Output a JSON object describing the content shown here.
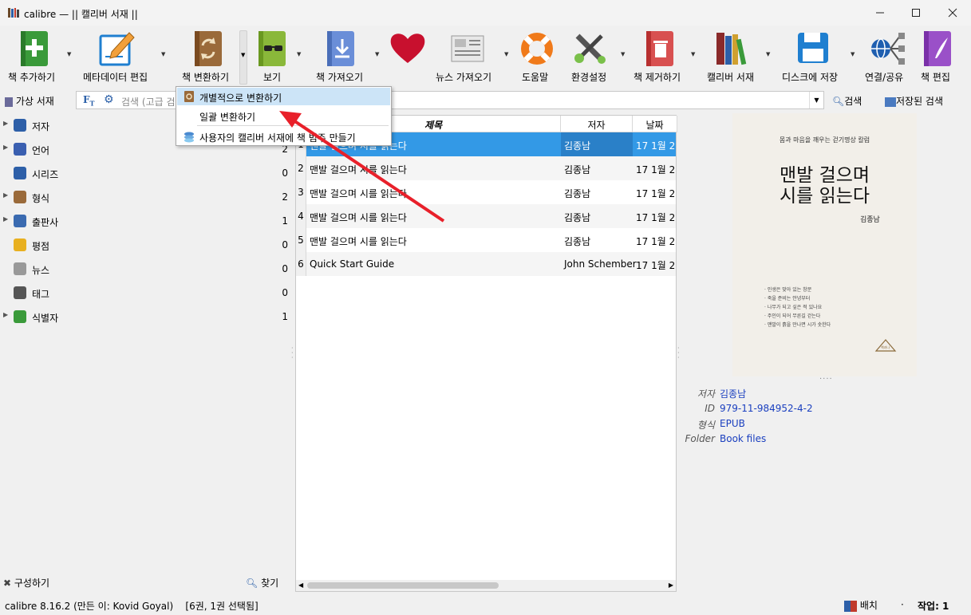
{
  "window": {
    "title": "calibre — || 캘리버 서재 ||",
    "controls": [
      "minimize",
      "maximize",
      "close"
    ]
  },
  "toolbar": {
    "items": [
      {
        "label": "책 추가하기",
        "icon": "add-book-icon",
        "has_menu": true
      },
      {
        "label": "메타데이터 편집",
        "icon": "edit-metadata-icon",
        "has_menu": true
      },
      {
        "label": "책 변환하기",
        "icon": "convert-book-icon",
        "has_menu": true
      },
      {
        "label": "보기",
        "icon": "view-book-icon",
        "has_menu": true
      },
      {
        "label": "책 가져오기",
        "icon": "get-books-icon",
        "has_menu": true
      },
      {
        "label": "",
        "icon": "heart-icon",
        "has_menu": false
      },
      {
        "label": "뉴스 가져오기",
        "icon": "news-icon",
        "has_menu": true
      },
      {
        "label": "도움말",
        "icon": "help-lifebuoy-icon",
        "has_menu": false
      },
      {
        "label": "환경설정",
        "icon": "preferences-icon",
        "has_menu": true
      },
      {
        "label": "책 제거하기",
        "icon": "remove-book-icon",
        "has_menu": true
      },
      {
        "label": "캘리버 서재",
        "icon": "library-icon",
        "has_menu": true
      },
      {
        "label": "디스크에 저장",
        "icon": "save-disk-icon",
        "has_menu": true
      },
      {
        "label": "연결/공유",
        "icon": "connect-share-icon",
        "has_menu": false
      },
      {
        "label": "책 편집",
        "icon": "edit-book-icon",
        "has_menu": false
      }
    ]
  },
  "search": {
    "virtual_library": "가상 서재",
    "placeholder": "검색 (고급 검",
    "search_button": "검색",
    "saved_search_button": "저장된 검색"
  },
  "convert_menu": {
    "items": [
      {
        "label": "개별적으로 변환하기",
        "icon": "convert-individual-icon"
      },
      {
        "label": "일괄 변환하기",
        "icon": ""
      },
      {
        "label": "사용자의 캘리버 서재에 책 범주 만들기",
        "icon": "library-category-icon"
      }
    ]
  },
  "tag_browser": {
    "items": [
      {
        "label": "저자",
        "count": "",
        "expandable": true,
        "icon": "author-icon"
      },
      {
        "label": "언어",
        "count": "2",
        "expandable": true,
        "icon": "language-icon"
      },
      {
        "label": "시리즈",
        "count": "0",
        "expandable": false,
        "icon": "series-icon"
      },
      {
        "label": "형식",
        "count": "2",
        "expandable": true,
        "icon": "format-icon"
      },
      {
        "label": "출판사",
        "count": "1",
        "expandable": true,
        "icon": "publisher-icon"
      },
      {
        "label": "평점",
        "count": "0",
        "expandable": false,
        "icon": "rating-star-icon"
      },
      {
        "label": "뉴스",
        "count": "0",
        "expandable": false,
        "icon": "news-small-icon"
      },
      {
        "label": "태그",
        "count": "0",
        "expandable": false,
        "icon": "tag-icon"
      },
      {
        "label": "식별자",
        "count": "1",
        "expandable": true,
        "icon": "barcode-icon"
      }
    ],
    "configure": "구성하기",
    "find": "찾기"
  },
  "book_list": {
    "columns": [
      "제목",
      "저자",
      "날짜"
    ],
    "rows": [
      {
        "num": "1",
        "title": "맨발 걸으며 시를 읽는다",
        "author": "김종남",
        "date": "17  1월 2",
        "selected": true
      },
      {
        "num": "2",
        "title": "맨발 걸으며 시를 읽는다",
        "author": "김종남",
        "date": "17  1월 2",
        "selected": false
      },
      {
        "num": "3",
        "title": "맨발 걸으며 시를 읽는다",
        "author": "김종남",
        "date": "17  1월 2",
        "selected": false
      },
      {
        "num": "4",
        "title": "맨발 걸으며 시를 읽는다",
        "author": "김종남",
        "date": "17  1월 2",
        "selected": false
      },
      {
        "num": "5",
        "title": "맨발 걸으며 시를 읽는다",
        "author": "김종남",
        "date": "17  1월 2",
        "selected": false
      },
      {
        "num": "6",
        "title": "Quick Start Guide",
        "author": "John Schember",
        "date": "17  1월 2",
        "selected": false
      }
    ]
  },
  "cover": {
    "subtitle": "몸과 마음을 깨우는 걷기명상 칼럼",
    "title_line1": "맨발 걸으며",
    "title_line2": "시를 읽는다",
    "author": "김종남",
    "bullets": [
      "· 인생은 맞아 있는 창문",
      "· 죽을 준비는 안녕부터",
      "· 나무가 되고 싶은 적 있나요",
      "· 주인이 되어 무른길 걷는다",
      "· 맨발이 흙을 만나면 시가 솟한다"
    ],
    "publisher_mark": "책과나"
  },
  "details": {
    "author_key": "저자",
    "author_val": "김종남",
    "id_key": "ID",
    "id_val": "979-11-984952-4-2",
    "format_key": "형식",
    "format_val": "EPUB",
    "folder_key": "Folder",
    "folder_val": "Book files"
  },
  "status": {
    "left": "calibre 8.16.2 (만든 이: Kovid Goyal)    [6권, 1권 선택됨]",
    "layout": "배치",
    "jobs": "작업: 1"
  },
  "colors": {
    "selected_row": "#3399e6",
    "link": "#1a3fbf",
    "arrow": "#e8202a"
  }
}
